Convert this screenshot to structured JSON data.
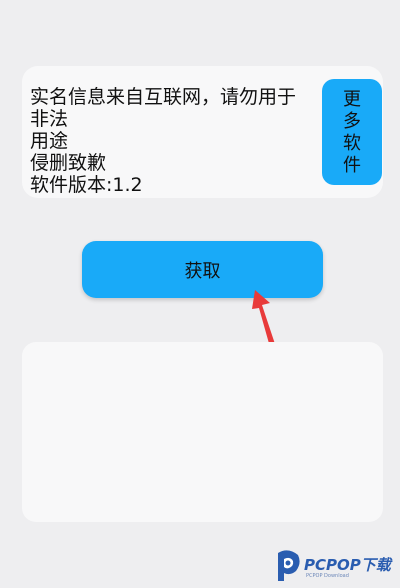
{
  "info": {
    "lines": [
      "实名信息来自互联网，请勿用于非法",
      "用途",
      "侵删致歉",
      "软件版本:1.2"
    ]
  },
  "more_button": {
    "chars": [
      "更",
      "多",
      "软",
      "件"
    ]
  },
  "get_button": {
    "label": "获取"
  },
  "result_box": {
    "text": ""
  },
  "watermark": {
    "brand": "PCPOP下载",
    "sub": "PCPOP Download"
  },
  "colors": {
    "background": "#eeeef0",
    "card": "#f8f8f9",
    "accent": "#19aaf8",
    "arrow": "#e83a3a",
    "watermark": "#2a5db0"
  }
}
